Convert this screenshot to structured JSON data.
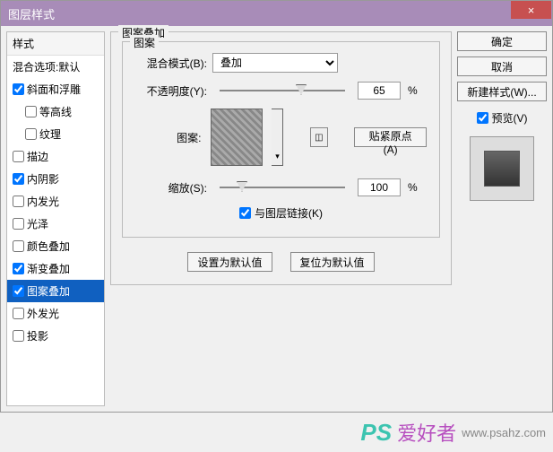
{
  "titlebar": {
    "title": "图层样式",
    "close": "×"
  },
  "sidebar": {
    "header": "样式",
    "blend": "混合选项:默认",
    "items": [
      {
        "label": "斜面和浮雕",
        "checked": true,
        "indent": false
      },
      {
        "label": "等高线",
        "checked": false,
        "indent": true
      },
      {
        "label": "纹理",
        "checked": false,
        "indent": true
      },
      {
        "label": "描边",
        "checked": false,
        "indent": false
      },
      {
        "label": "内阴影",
        "checked": true,
        "indent": false
      },
      {
        "label": "内发光",
        "checked": false,
        "indent": false
      },
      {
        "label": "光泽",
        "checked": false,
        "indent": false
      },
      {
        "label": "颜色叠加",
        "checked": false,
        "indent": false
      },
      {
        "label": "渐变叠加",
        "checked": true,
        "indent": false
      },
      {
        "label": "图案叠加",
        "checked": true,
        "indent": false,
        "selected": true
      },
      {
        "label": "外发光",
        "checked": false,
        "indent": false
      },
      {
        "label": "投影",
        "checked": false,
        "indent": false
      }
    ]
  },
  "main": {
    "outer_title": "图案叠加",
    "inner_title": "图案",
    "blend_mode_label": "混合模式(B):",
    "blend_mode_value": "叠加",
    "opacity_label": "不透明度(Y):",
    "opacity_value": "65",
    "pattern_label": "图案:",
    "snap_btn": "贴紧原点(A)",
    "scale_label": "缩放(S):",
    "scale_value": "100",
    "percent": "%",
    "link_label": "与图层链接(K)",
    "set_default": "设置为默认值",
    "reset_default": "复位为默认值"
  },
  "right": {
    "ok": "确定",
    "cancel": "取消",
    "new_style": "新建样式(W)...",
    "preview_label": "预览(V)"
  },
  "watermark": {
    "ps": "PS",
    "cn": "爱好者",
    "url": "www.psahz.com"
  }
}
